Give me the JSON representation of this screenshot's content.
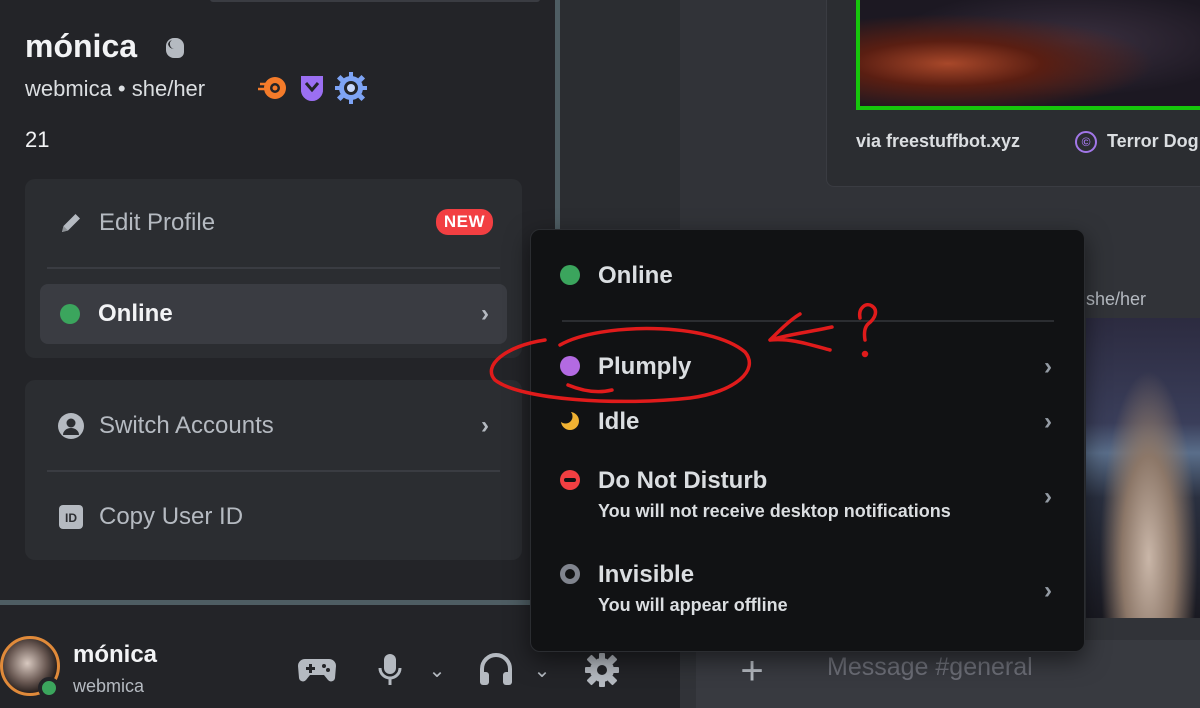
{
  "background": {
    "embed_source": "via freestuffbot.xyz",
    "embed_publisher": "Terror Dog",
    "embed_copyright_icon": "©",
    "pronouns_fragment": "she/her",
    "message_placeholder": "Message #general"
  },
  "profile": {
    "display_name": "mónica",
    "username_line": "webmica • she/her",
    "bio": "21",
    "badges": [
      "orange-swirl-badge",
      "purple-shield-badge",
      "blue-gear-badge"
    ],
    "menu": {
      "edit_profile": "Edit Profile",
      "new_badge": "NEW",
      "online": "Online",
      "switch_accounts": "Switch Accounts",
      "copy_user_id": "Copy User ID"
    }
  },
  "user_panel": {
    "display_name": "mónica",
    "username": "webmica",
    "status": "online"
  },
  "status_menu": {
    "items": [
      {
        "label": "Online",
        "sub": "",
        "color": "#3ba55d"
      },
      {
        "label": "Plumply",
        "sub": "",
        "color": "#b36ae2"
      },
      {
        "label": "Idle",
        "sub": "",
        "color": "#f0b232"
      },
      {
        "label": "Do Not Disturb",
        "sub": "You will not receive desktop notifications",
        "color": "#f23f42"
      },
      {
        "label": "Invisible",
        "sub": "You will appear offline",
        "color": "#80848e"
      }
    ]
  },
  "annotation": {
    "mark": "?",
    "color": "#e01b1b"
  },
  "colors": {
    "online": "#3ba55d",
    "accent_red": "#f23f42",
    "embed_border": "#16c60c"
  }
}
